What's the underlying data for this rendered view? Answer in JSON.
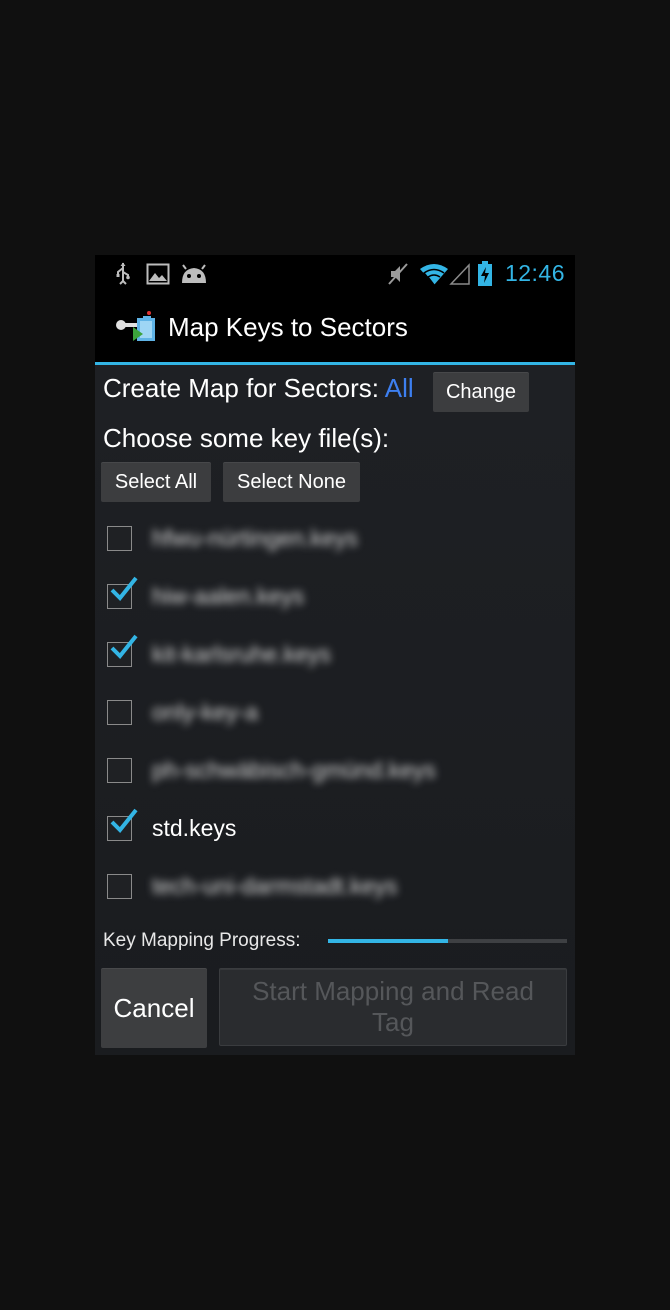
{
  "status_bar": {
    "time": "12:46",
    "icons": [
      "usb-icon",
      "image-notification-icon",
      "android-debug-icon",
      "mute-icon",
      "wifi-icon",
      "cell-signal-icon",
      "battery-charging-icon"
    ]
  },
  "action_bar": {
    "title": "Map Keys to Sectors",
    "icon": "app-logo-icon"
  },
  "sectors": {
    "label": "Create Map for Sectors:",
    "value": "All",
    "change_button": "Change"
  },
  "key_files": {
    "label": "Choose some key file(s):",
    "select_all_button": "Select All",
    "select_none_button": "Select None",
    "items": [
      {
        "label": "hfwu-nürtingen.keys",
        "checked": false,
        "blurred": true
      },
      {
        "label": "hiw-aalen.keys",
        "checked": true,
        "blurred": true
      },
      {
        "label": "kit-karlsruhe.keys",
        "checked": true,
        "blurred": true
      },
      {
        "label": "only-key-a",
        "checked": false,
        "blurred": true
      },
      {
        "label": "ph-schwäbisch-gmünd.keys",
        "checked": false,
        "blurred": true
      },
      {
        "label": "std.keys",
        "checked": true,
        "blurred": false
      },
      {
        "label": "tech-uni-darmstadt.keys",
        "checked": false,
        "blurred": true
      }
    ]
  },
  "progress": {
    "label": "Key Mapping Progress:",
    "value_fraction": 0.5
  },
  "buttons": {
    "cancel": "Cancel",
    "start": "Start Mapping and Read Tag",
    "start_enabled": false
  },
  "colors": {
    "accent": "#33b5e5",
    "link": "#3d7ff0",
    "background": "#1b1d20",
    "outer": "#101010"
  }
}
